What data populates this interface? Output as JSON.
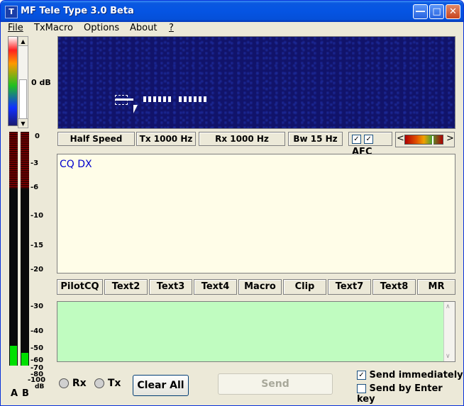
{
  "window": {
    "title": "MF Tele Type 3.0 Beta",
    "icon": "T"
  },
  "menu": {
    "items": [
      "File",
      "TxMacro",
      "Options",
      "About",
      "?"
    ]
  },
  "spectrum": {
    "gain_label": "0 dB"
  },
  "status": {
    "speed": "Half Speed",
    "tx_freq": "Tx 1000 Hz",
    "rx_freq": "Rx 1000 Hz",
    "bandwidth": "Bw 15 Hz",
    "afc_label": "AFC",
    "afc_checked": true,
    "tune_left": "<",
    "tune_right": ">"
  },
  "rx": {
    "text": "CQ DX"
  },
  "macros": [
    "PilotCQ",
    "Text2",
    "Text3",
    "Text4",
    "Macro",
    "Clip",
    "Text7",
    "Text8",
    "MR"
  ],
  "meter": {
    "scale": [
      "0",
      "-3",
      "-6",
      "-10",
      "-15",
      "-20",
      "-30",
      "-40",
      "-50",
      "-60",
      "-70",
      "-80",
      "-100",
      "dB"
    ],
    "channel_a_label": "A",
    "channel_b_label": "B"
  },
  "controls": {
    "rx_label": "Rx",
    "tx_label": "Tx",
    "clear_all": "Clear All",
    "send": "Send",
    "send_immediately": "Send immediately",
    "send_immediately_checked": true,
    "send_by_enter": "Send by Enter key",
    "send_by_enter_checked": false
  }
}
